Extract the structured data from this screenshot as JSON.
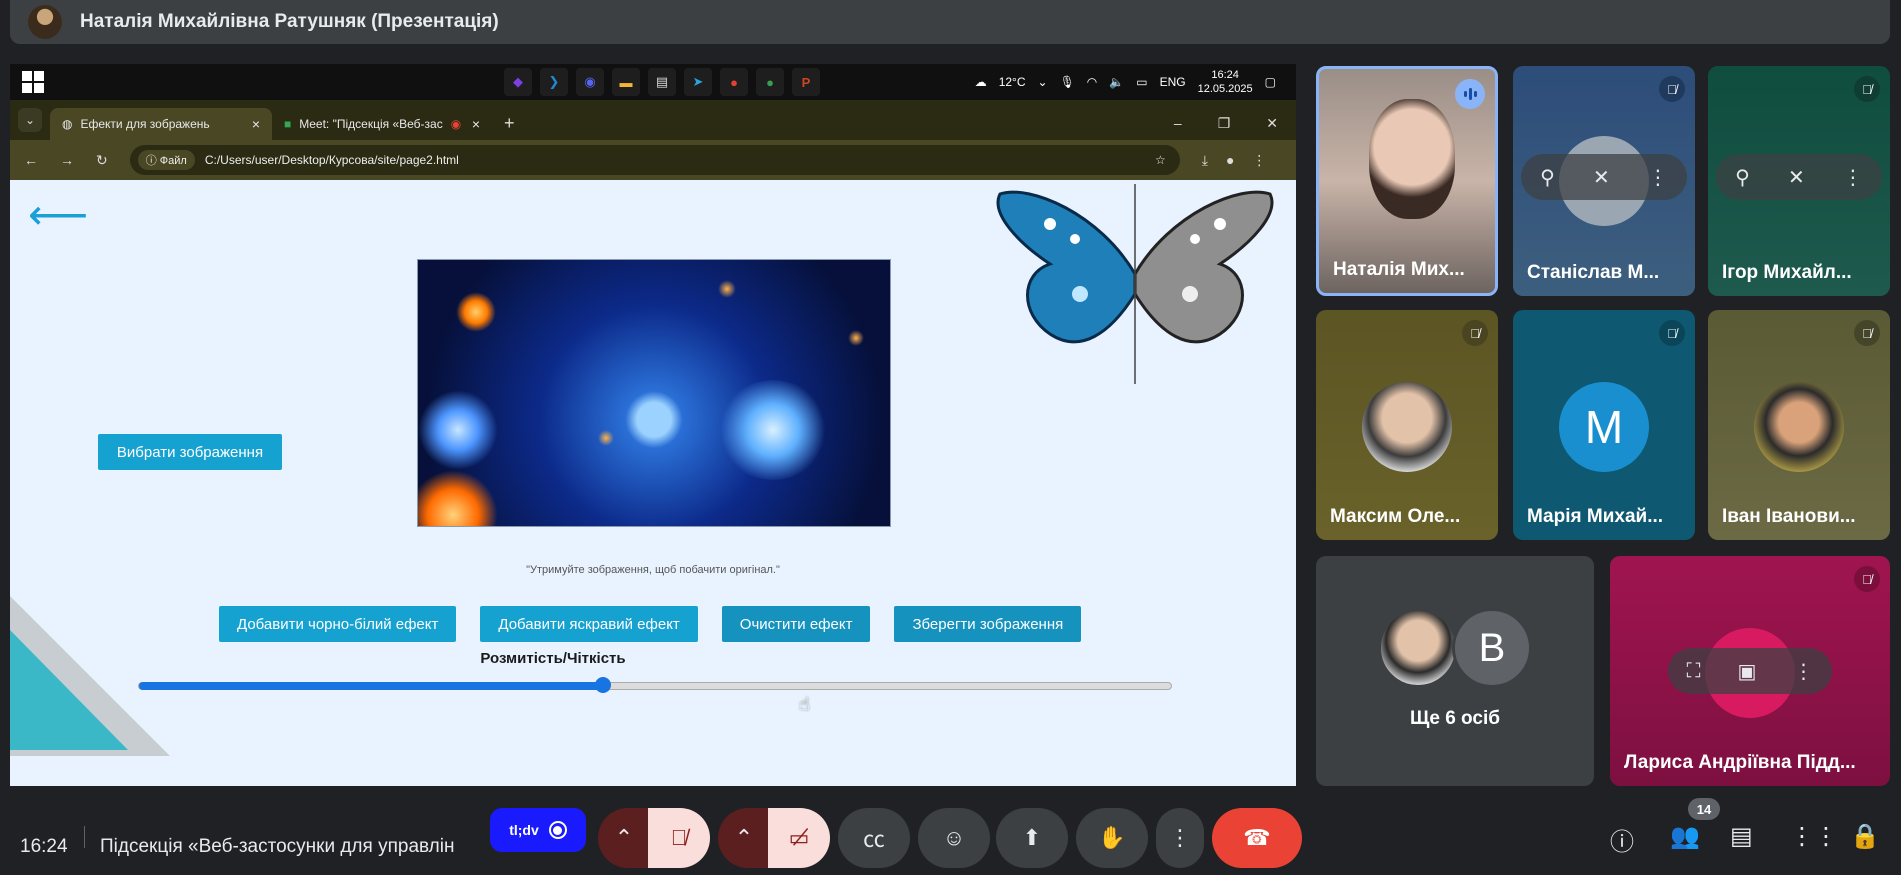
{
  "presenter": {
    "title": "Наталія Михайлівна Ратушняк (Презентація)"
  },
  "taskbar": {
    "apps": [
      {
        "icon": "visual-studio-icon",
        "glyph": "◆",
        "color": "#7b3fe4"
      },
      {
        "icon": "vscode-icon",
        "glyph": "❯",
        "color": "#1f8ad2"
      },
      {
        "icon": "discord-icon",
        "glyph": "◉",
        "color": "#5865f2"
      },
      {
        "icon": "folder-icon",
        "glyph": "▬",
        "color": "#f2b632"
      },
      {
        "icon": "file-icon",
        "glyph": "▤",
        "color": "#d9d9d9"
      },
      {
        "icon": "telegram-icon",
        "glyph": "➤",
        "color": "#2aa3df"
      },
      {
        "icon": "chrome-icon",
        "glyph": "●",
        "color": "#e34133"
      },
      {
        "icon": "chrome-profile-icon",
        "glyph": "●",
        "color": "#3a9d52"
      },
      {
        "icon": "powerpoint-icon",
        "glyph": "P",
        "color": "#d04423"
      }
    ],
    "temperature": "12°C",
    "language": "ENG",
    "time": "16:24",
    "date": "12.05.2025"
  },
  "browser": {
    "tabs": [
      {
        "label": "Ефекти для зображень",
        "active": true
      },
      {
        "label": "Meet: \"Підсекція «Веб-зас",
        "active": false
      }
    ],
    "address_chip": "Файл",
    "address": "C:/Users/user/Desktop/Курсова/site/page2.html"
  },
  "webpage": {
    "pick_button": "Вибрати зображення",
    "hint": "\"Утримуйте зображення, щоб побачити оригінал.\"",
    "buttons": [
      {
        "label": "Добавити чорно-білий ефект",
        "color": "#16a2d1"
      },
      {
        "label": "Добавити яскравий ефект",
        "color": "#16a2d1"
      },
      {
        "label": "Очистити ефект",
        "color": "#1592bd"
      },
      {
        "label": "Зберегти зображення",
        "color": "#1592bd"
      }
    ],
    "slider_label": "Розмитість/Чіткість",
    "slider_value": 0.45
  },
  "participants": [
    {
      "name": "Наталія Мих...",
      "state": "speaking"
    },
    {
      "name": "Станіслав М...",
      "state": "muted"
    },
    {
      "name": "Ігор Михайл...",
      "state": "muted"
    },
    {
      "name": "Максим Оле...",
      "state": "muted"
    },
    {
      "name": "Марія Михай...",
      "state": "muted",
      "initial": "M"
    },
    {
      "name": "Іван Іванови...",
      "state": "muted"
    },
    {
      "name": "Ще 6 осіб",
      "initial": "B"
    },
    {
      "name": "Лариса Андріївна Підд...",
      "state": "muted"
    }
  ],
  "bottombar": {
    "time": "16:24",
    "meeting_title": "Підсекція «Веб-застосунки для управлін",
    "pill_label": "tl;dv",
    "participant_count": "14"
  },
  "colors": {
    "accent": "#16a2d1",
    "end_call": "#ea4335",
    "muted_red": "#f9dedc"
  }
}
